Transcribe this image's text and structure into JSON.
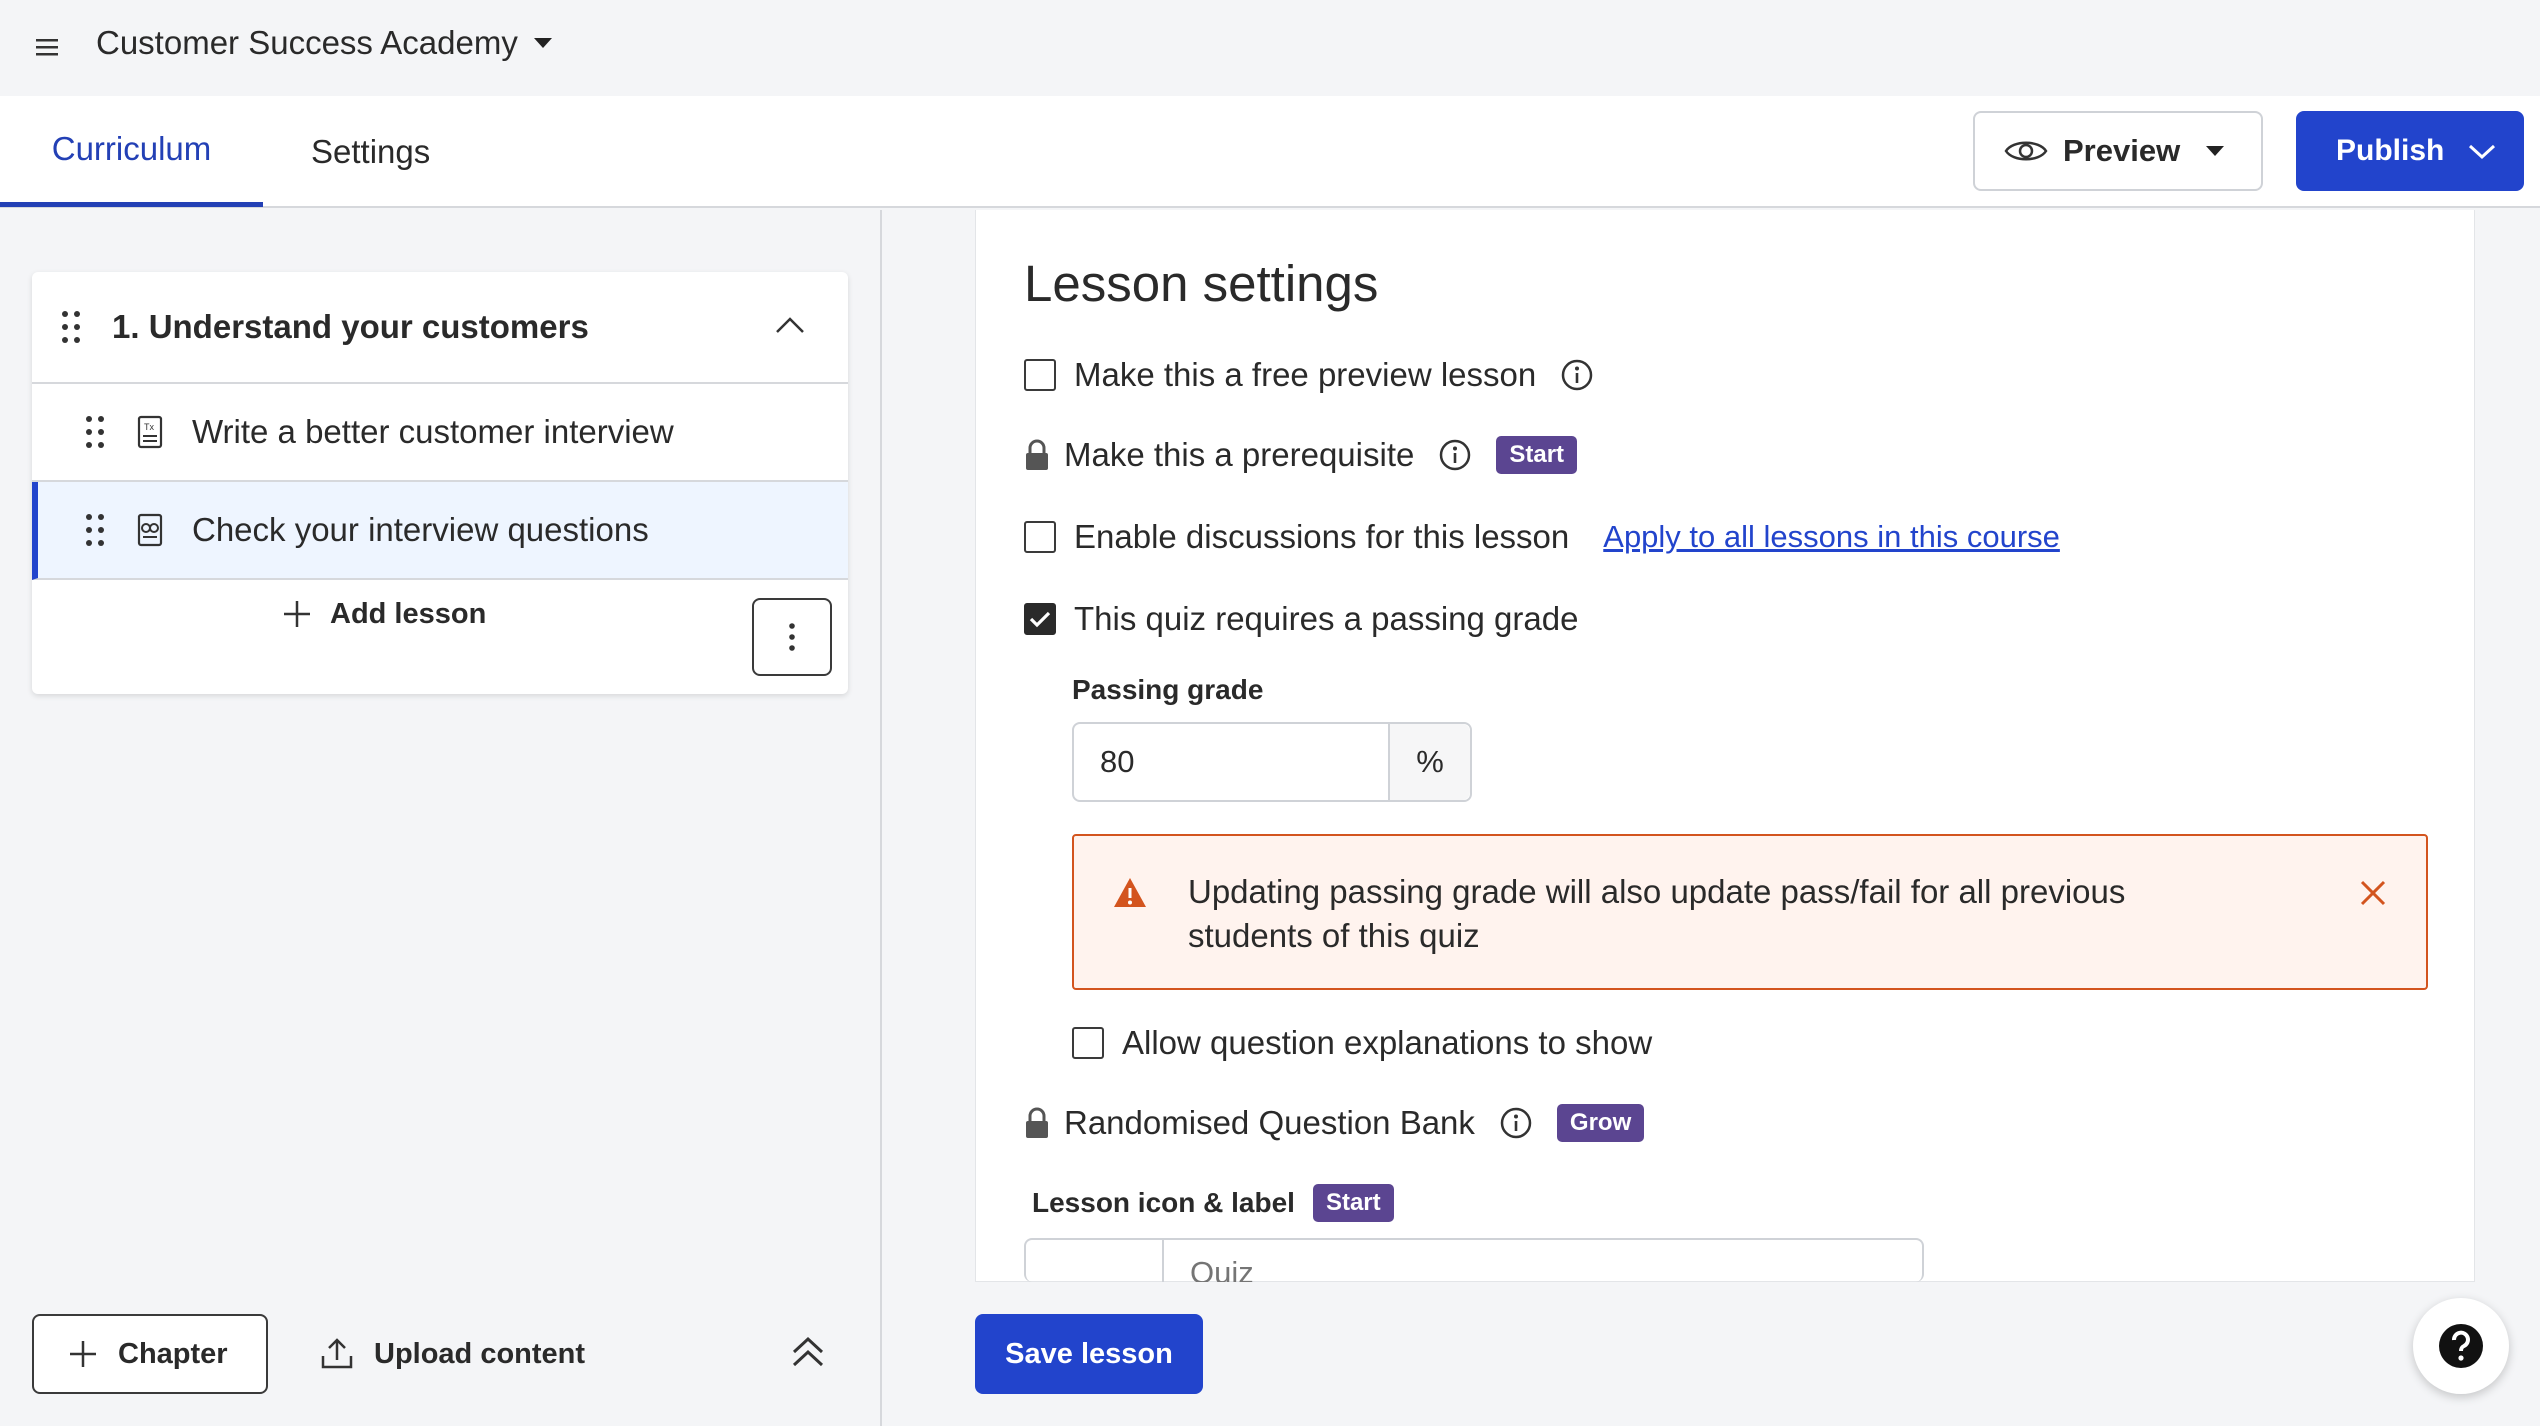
{
  "header": {
    "course_title": "Customer Success Academy"
  },
  "tabs": {
    "curriculum": "Curriculum",
    "settings": "Settings"
  },
  "actions": {
    "preview_label": "Preview",
    "publish_label": "Publish"
  },
  "sidebar": {
    "chapter_title": "1. Understand your customers",
    "lessons": [
      {
        "label": "Write a better customer interview",
        "icon": "text-lesson-icon",
        "active": false
      },
      {
        "label": "Check your interview questions",
        "icon": "quiz-lesson-icon",
        "active": true
      }
    ],
    "add_lesson_label": "Add lesson",
    "chapter_button_label": "Chapter",
    "upload_button_label": "Upload content"
  },
  "lesson_settings": {
    "title": "Lesson settings",
    "free_preview_label": "Make this a free preview lesson",
    "prerequisite_label": "Make this a prerequisite",
    "prerequisite_badge": "Start",
    "discussions_label": "Enable discussions for this lesson",
    "apply_all_link": "Apply to all lessons in this course",
    "passing_grade_toggle_label": "This quiz requires a passing grade",
    "passing_grade_label": "Passing grade",
    "passing_grade_value": "80",
    "passing_grade_unit": "%",
    "warning_text": "Updating passing grade will also update pass/fail for all previous students of this quiz",
    "explanations_label": "Allow question explanations to show",
    "question_bank_label": "Randomised Question Bank",
    "question_bank_badge": "Grow",
    "icon_label_title": "Lesson icon & label",
    "icon_label_badge": "Start",
    "label_placeholder": "Quiz",
    "free_preview_checked": false,
    "discussions_checked": false,
    "passing_grade_checked": true,
    "explanations_checked": false
  },
  "footer": {
    "save_label": "Save lesson"
  },
  "colors": {
    "accent": "#2244cc",
    "badge": "#5b4591",
    "warning_border": "#d3541e",
    "warning_bg": "#fff3ee"
  }
}
